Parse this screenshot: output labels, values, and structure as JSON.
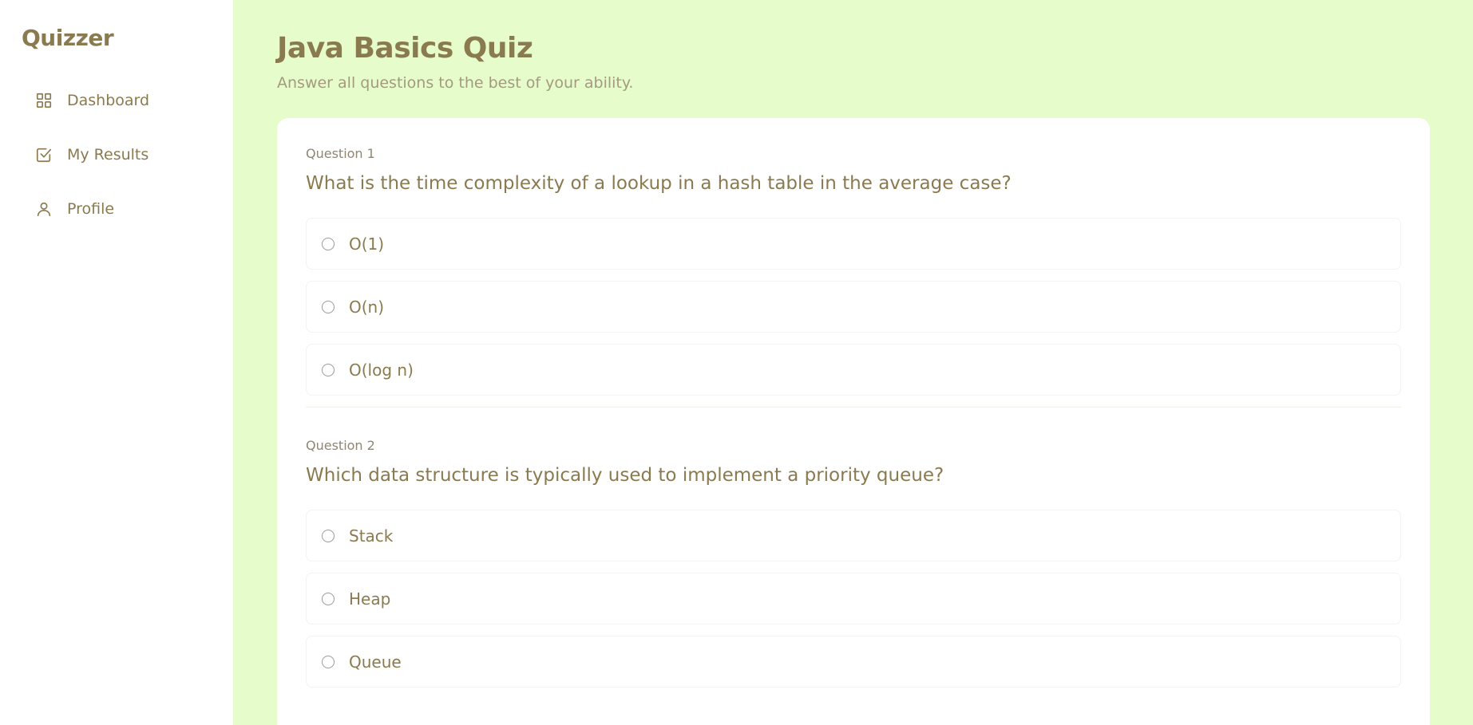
{
  "sidebar": {
    "brand": "Quizzer",
    "items": [
      {
        "label": "Dashboard",
        "icon": "grid-icon"
      },
      {
        "label": "My Results",
        "icon": "checkbox-icon"
      },
      {
        "label": "Profile",
        "icon": "user-icon"
      }
    ]
  },
  "header": {
    "title": "Java Basics Quiz",
    "subtitle": "Answer all questions to the best of your ability."
  },
  "questions": [
    {
      "number": "Question 1",
      "text": "What is the time complexity of a lookup in a hash table in the average case?",
      "options": [
        "O(1)",
        "O(n)",
        "O(log n)"
      ]
    },
    {
      "number": "Question 2",
      "text": "Which data structure is typically used to implement a priority queue?",
      "options": [
        "Stack",
        "Heap",
        "Queue"
      ]
    }
  ],
  "colors": {
    "background": "#e6fccb",
    "text": "#8a7a4f",
    "sidebar": "#ffffff",
    "card": "#ffffff"
  }
}
